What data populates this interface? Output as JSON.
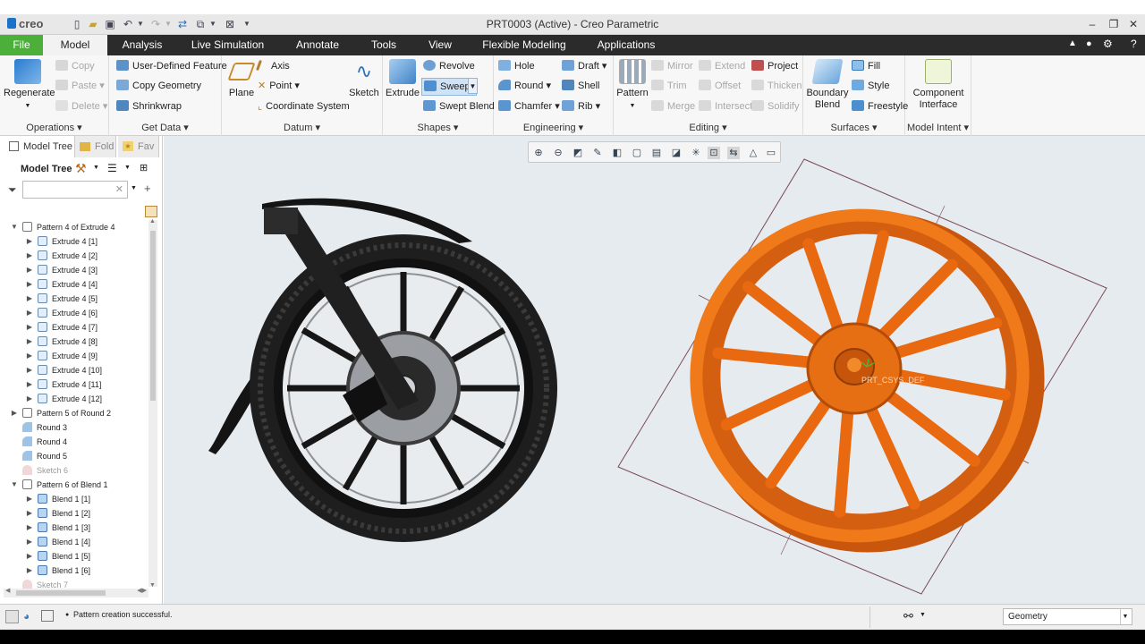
{
  "app": {
    "logo": "creo",
    "window_title": "PRT0003 (Active) - Creo Parametric"
  },
  "tabs": [
    {
      "label": "File"
    },
    {
      "label": "Model"
    },
    {
      "label": "Analysis"
    },
    {
      "label": "Live Simulation"
    },
    {
      "label": "Annotate"
    },
    {
      "label": "Tools"
    },
    {
      "label": "View"
    },
    {
      "label": "Flexible Modeling"
    },
    {
      "label": "Applications"
    }
  ],
  "ribbon": {
    "operations": {
      "label": "Operations",
      "regenerate": "Regenerate",
      "copy": "Copy",
      "paste": "Paste",
      "delete": "Delete"
    },
    "get_data": {
      "label": "Get Data",
      "udf": "User-Defined Feature",
      "copy_geometry": "Copy Geometry",
      "shrinkwrap": "Shrinkwrap"
    },
    "datum": {
      "label": "Datum",
      "plane": "Plane",
      "axis": "Axis",
      "point": "Point",
      "coordinate_system": "Coordinate System",
      "sketch": "Sketch"
    },
    "shapes": {
      "label": "Shapes",
      "extrude": "Extrude",
      "revolve": "Revolve",
      "sweep": "Sweep",
      "swept_blend": "Swept Blend"
    },
    "engineering": {
      "label": "Engineering",
      "hole": "Hole",
      "round": "Round",
      "chamfer": "Chamfer",
      "draft": "Draft",
      "shell": "Shell",
      "rib": "Rib"
    },
    "editing": {
      "label": "Editing",
      "pattern": "Pattern",
      "mirror": "Mirror",
      "trim": "Trim",
      "merge": "Merge",
      "extend": "Extend",
      "offset": "Offset",
      "intersect": "Intersect",
      "project": "Project",
      "thicken": "Thicken",
      "solidify": "Solidify"
    },
    "surfaces": {
      "label": "Surfaces",
      "boundary_blend": "Boundary Blend",
      "fill": "Fill",
      "style": "Style",
      "freestyle": "Freestyle"
    },
    "model_intent": {
      "label": "Model Intent",
      "component_interface": "Component Interface"
    }
  },
  "left_panel": {
    "tabs": [
      "Model Tree",
      "Fold",
      "Fav"
    ],
    "tree_label": "Model Tree",
    "items": [
      {
        "label": "Pattern 4 of Extrude 4",
        "level": 0,
        "icon": "pattern-icon",
        "expanded": true
      },
      {
        "label": "Extrude 4 [1]",
        "level": 1,
        "icon": "extrude-icon"
      },
      {
        "label": "Extrude 4 [2]",
        "level": 1,
        "icon": "extrude-icon"
      },
      {
        "label": "Extrude 4 [3]",
        "level": 1,
        "icon": "extrude-icon"
      },
      {
        "label": "Extrude 4 [4]",
        "level": 1,
        "icon": "extrude-icon"
      },
      {
        "label": "Extrude 4 [5]",
        "level": 1,
        "icon": "extrude-icon"
      },
      {
        "label": "Extrude 4 [6]",
        "level": 1,
        "icon": "extrude-icon"
      },
      {
        "label": "Extrude 4 [7]",
        "level": 1,
        "icon": "extrude-icon"
      },
      {
        "label": "Extrude 4 [8]",
        "level": 1,
        "icon": "extrude-icon"
      },
      {
        "label": "Extrude 4 [9]",
        "level": 1,
        "icon": "extrude-icon"
      },
      {
        "label": "Extrude 4 [10]",
        "level": 1,
        "icon": "extrude-icon"
      },
      {
        "label": "Extrude 4 [11]",
        "level": 1,
        "icon": "extrude-icon"
      },
      {
        "label": "Extrude 4 [12]",
        "level": 1,
        "icon": "extrude-icon"
      },
      {
        "label": "Pattern 5 of Round 2",
        "level": 0,
        "icon": "pattern-icon",
        "expanded": false
      },
      {
        "label": "Round 3",
        "level": 0,
        "icon": "round-icon"
      },
      {
        "label": "Round 4",
        "level": 0,
        "icon": "round-icon"
      },
      {
        "label": "Round 5",
        "level": 0,
        "icon": "round-icon"
      },
      {
        "label": "Sketch 6",
        "level": 0,
        "icon": "sketch-icon",
        "dim": true
      },
      {
        "label": "Pattern 6 of Blend 1",
        "level": 0,
        "icon": "pattern-icon",
        "expanded": true
      },
      {
        "label": "Blend 1 [1]",
        "level": 1,
        "icon": "blend-icon"
      },
      {
        "label": "Blend 1 [2]",
        "level": 1,
        "icon": "blend-icon"
      },
      {
        "label": "Blend 1 [3]",
        "level": 1,
        "icon": "blend-icon"
      },
      {
        "label": "Blend 1 [4]",
        "level": 1,
        "icon": "blend-icon"
      },
      {
        "label": "Blend 1 [5]",
        "level": 1,
        "icon": "blend-icon"
      },
      {
        "label": "Blend 1 [6]",
        "level": 1,
        "icon": "blend-icon"
      },
      {
        "label": "Sketch 7",
        "level": 0,
        "icon": "sketch-icon",
        "dim": true
      }
    ]
  },
  "viewport": {
    "datum_label": "PRT_CSYS_DEF",
    "model_color": "#e8690f"
  },
  "status": {
    "message": "Pattern creation successful.",
    "filter": "Geometry"
  }
}
